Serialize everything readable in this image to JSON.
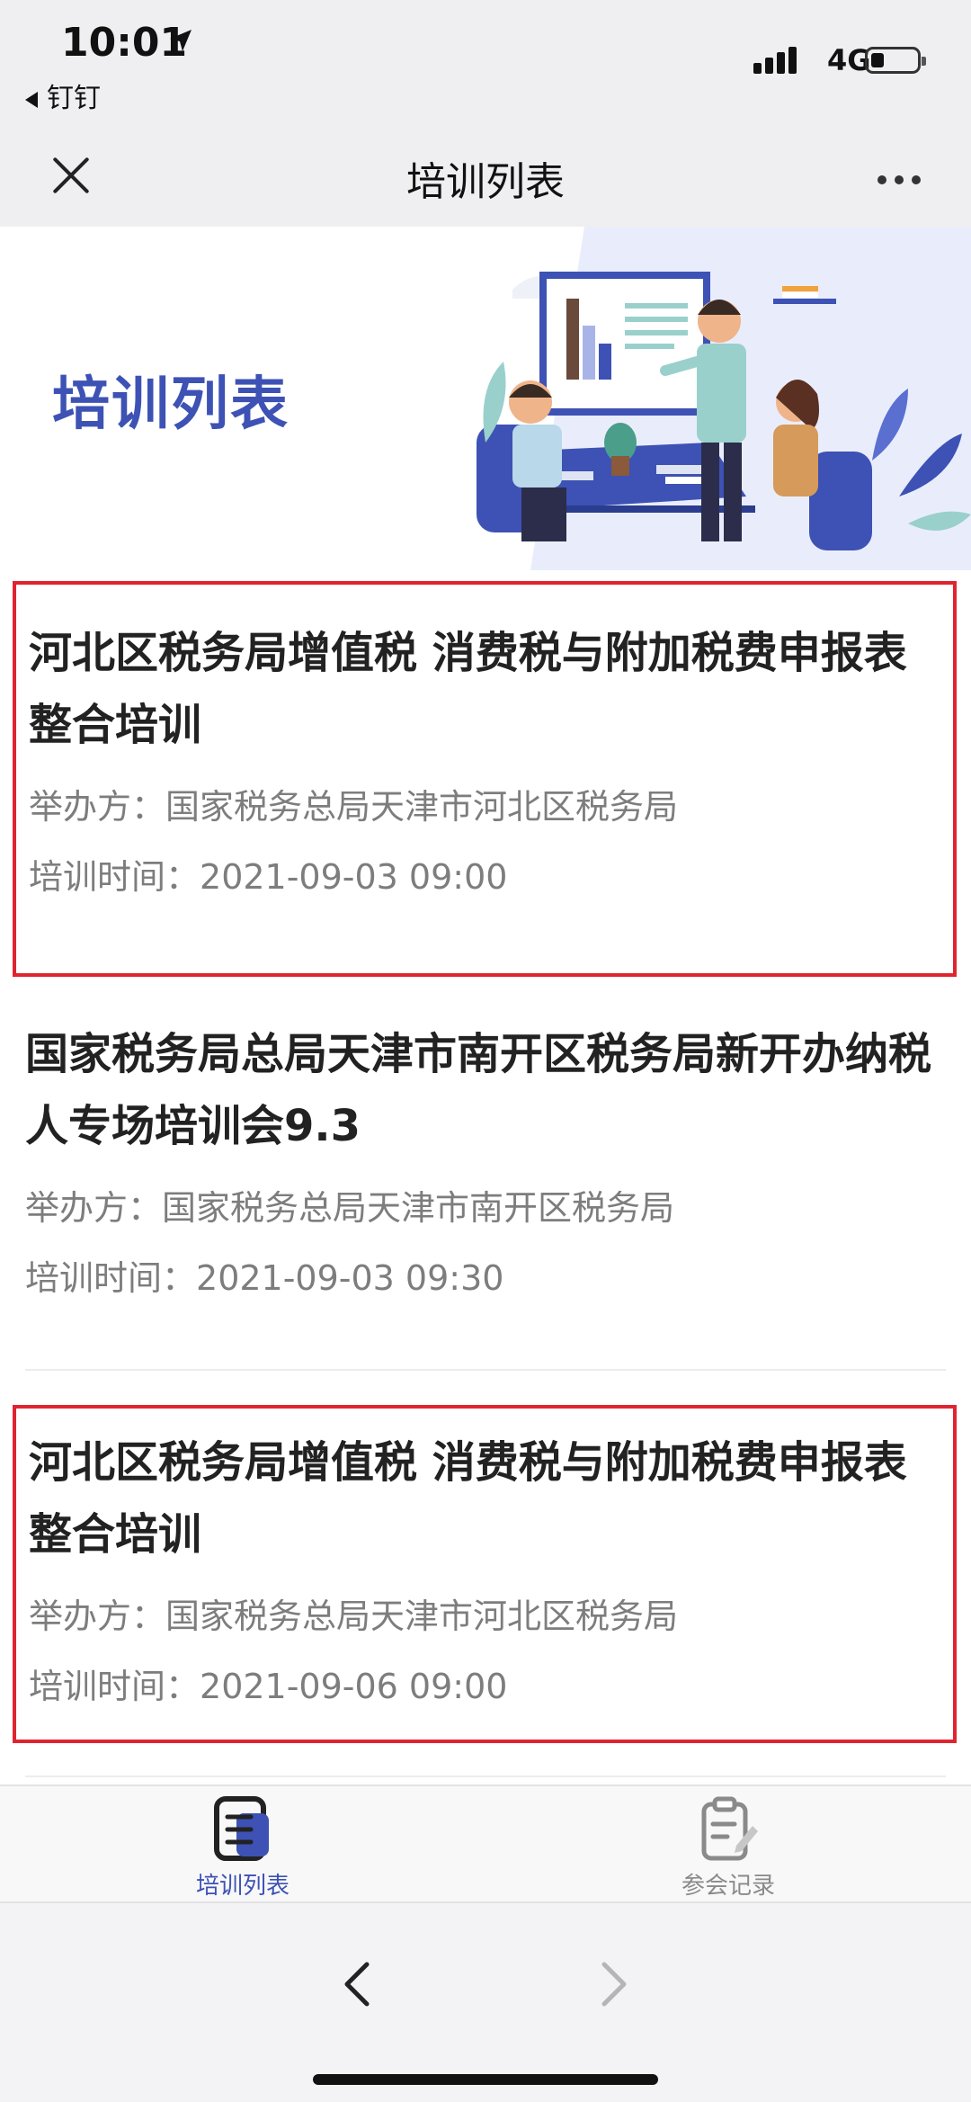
{
  "status_bar": {
    "time": "10:01",
    "back_app": "钉钉",
    "network": "4G"
  },
  "nav": {
    "title": "培训列表"
  },
  "banner": {
    "title": "培训列表"
  },
  "trainings": [
    {
      "title": "河北区税务局增值税 消费税与附加税费申报表整合培训",
      "organizer_label": "举办方：",
      "organizer": "国家税务总局天津市河北区税务局",
      "time_label": "培训时间：",
      "time": "2021-09-03 09:00"
    },
    {
      "title": "国家税务局总局天津市南开区税务局新开办纳税人专场培训会9.3",
      "organizer_label": "举办方：",
      "organizer": "国家税务总局天津市南开区税务局",
      "time_label": "培训时间：",
      "time": "2021-09-03 09:30"
    },
    {
      "title": "河北区税务局增值税 消费税与附加税费申报表整合培训",
      "organizer_label": "举办方：",
      "organizer": "国家税务总局天津市河北区税务局",
      "time_label": "培训时间：",
      "time": "2021-09-06 09:00"
    }
  ],
  "tabs": [
    {
      "label": "培训列表",
      "icon": "list-document-icon",
      "active": true
    },
    {
      "label": "参会记录",
      "icon": "clipboard-edit-icon",
      "active": false
    }
  ],
  "colors": {
    "accent": "#3d52b4",
    "highlight_border": "#e0242f",
    "meta_text": "#7d7d7d"
  }
}
